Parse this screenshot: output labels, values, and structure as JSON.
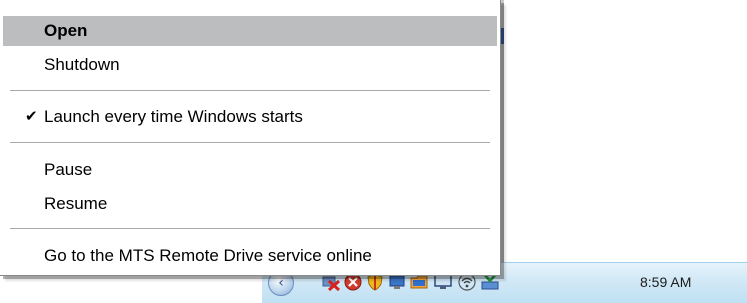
{
  "context_menu": {
    "items": [
      {
        "label": "Open",
        "highlighted": true
      },
      {
        "label": "Shutdown"
      },
      {
        "label": "Launch every time Windows starts",
        "checked": true
      },
      {
        "label": "Pause"
      },
      {
        "label": "Resume"
      },
      {
        "label": "Go to the MTS Remote Drive service online"
      }
    ],
    "check_glyph": "✔",
    "highlight_color": "#bcbdbe"
  },
  "taskbar": {
    "chevron_glyph": "‹",
    "clock": "8:59 AM",
    "tray_icons": [
      "expand-tray-icon",
      "network-disconnected-icon",
      "security-alert-icon",
      "shield-icon",
      "network-icon",
      "folder-icon",
      "monitor-icon",
      "wireless-icon",
      "remote-drive-icon"
    ]
  }
}
